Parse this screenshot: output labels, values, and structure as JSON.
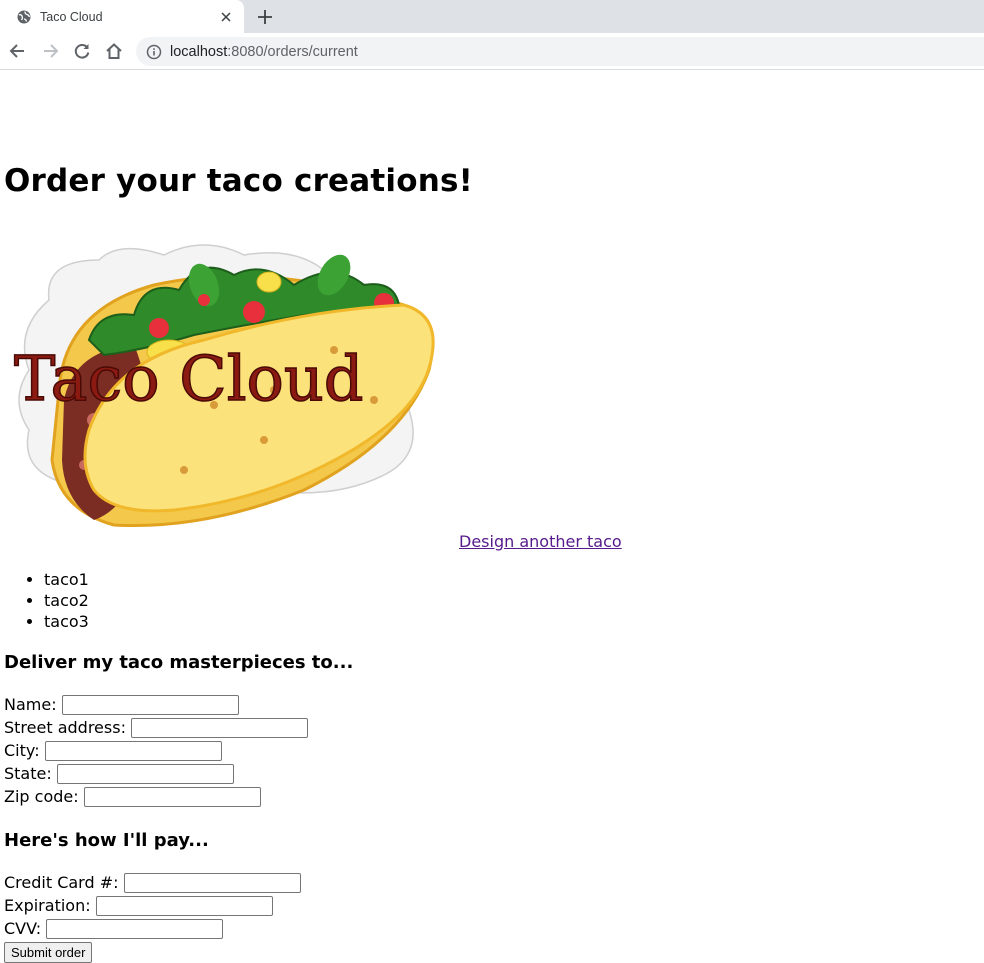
{
  "browser": {
    "tab_title": "Taco Cloud",
    "url_host": "localhost",
    "url_rest": ":8080/orders/current"
  },
  "page": {
    "title": "Order your taco creations!",
    "design_link": "Design another taco",
    "tacos": [
      "taco1",
      "taco2",
      "taco3"
    ],
    "logo_text": "Taco Cloud",
    "deliver_heading": "Deliver my taco masterpieces to...",
    "pay_heading": "Here's how I'll pay...",
    "delivery_fields": [
      {
        "label": "Name:",
        "value": ""
      },
      {
        "label": "Street address:",
        "value": ""
      },
      {
        "label": "City:",
        "value": ""
      },
      {
        "label": "State:",
        "value": ""
      },
      {
        "label": "Zip code:",
        "value": ""
      }
    ],
    "payment_fields": [
      {
        "label": "Credit Card #:",
        "value": ""
      },
      {
        "label": "Expiration:",
        "value": ""
      },
      {
        "label": "CVV:",
        "value": ""
      }
    ],
    "submit_label": "Submit order"
  },
  "colors": {
    "link_visited": "#551a8b",
    "tabstrip_bg": "#dee1e6",
    "omnibox_bg": "#f1f3f4"
  },
  "icons": [
    "globe-icon",
    "close-icon",
    "plus-icon",
    "back-arrow-icon",
    "forward-arrow-icon",
    "reload-icon",
    "home-icon",
    "info-icon"
  ]
}
